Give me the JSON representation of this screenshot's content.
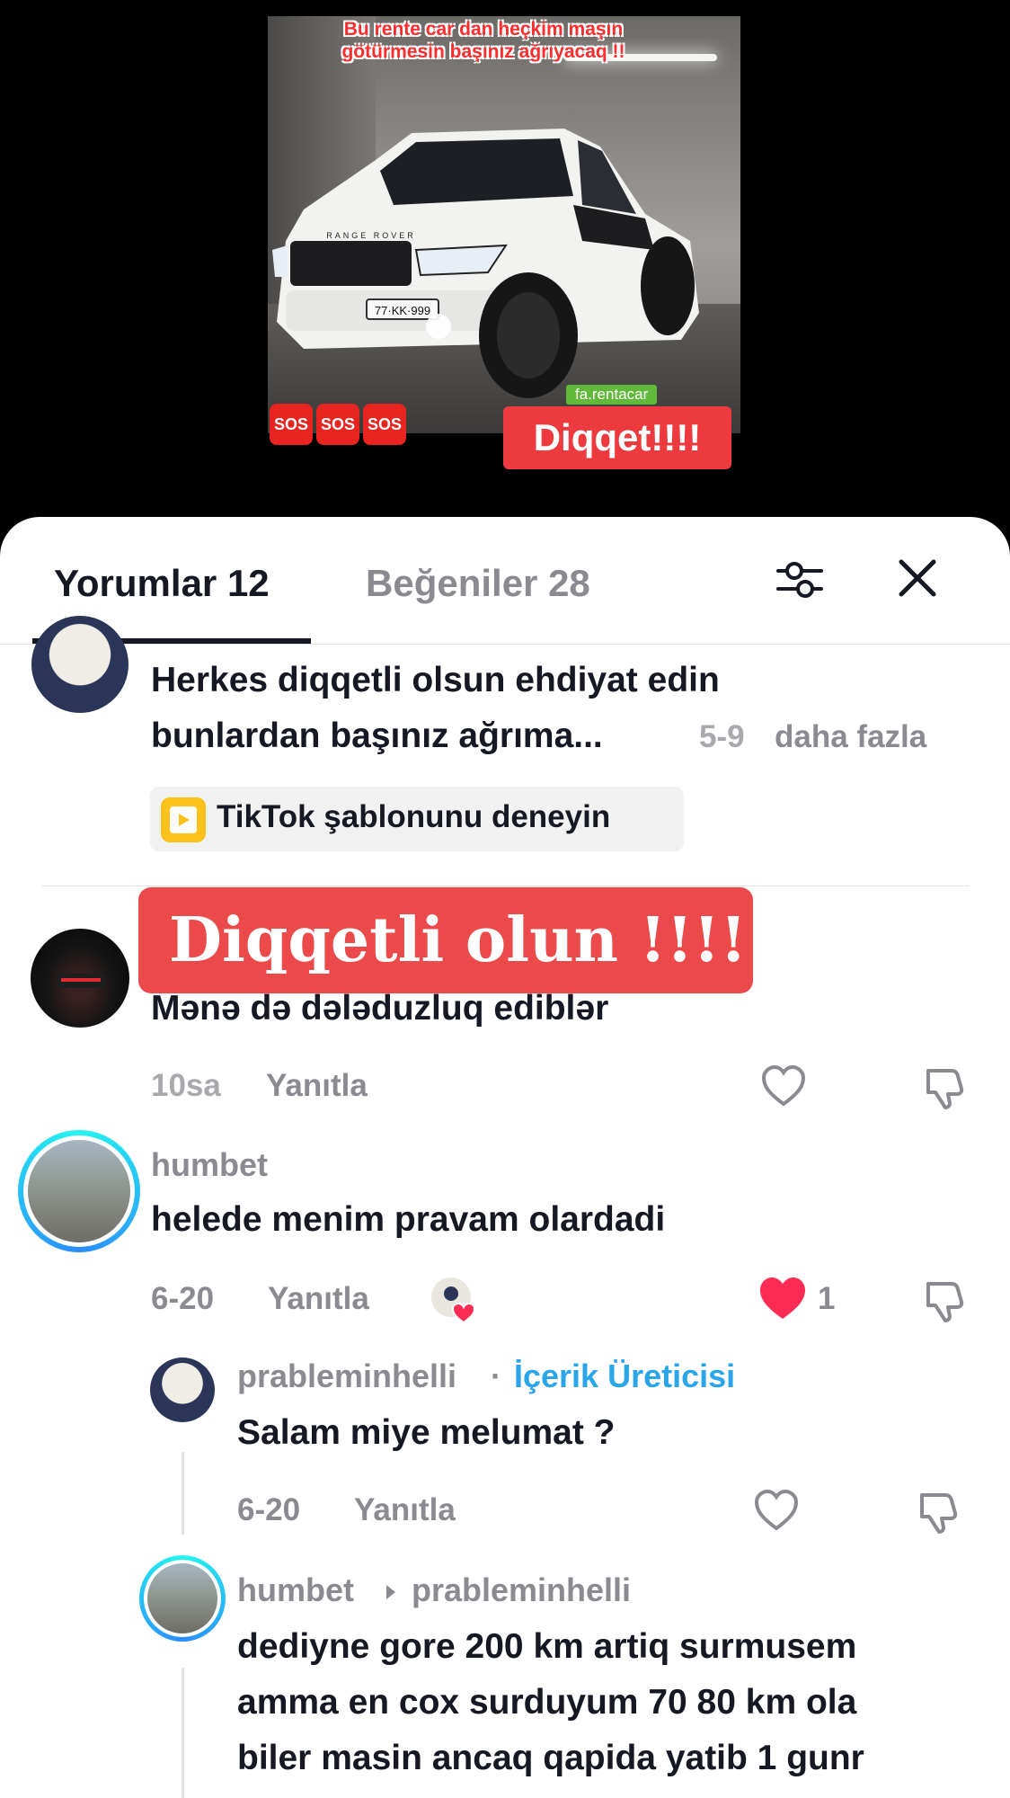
{
  "video": {
    "caption": "Bu rente car dan heçkim maşın götürmesin başınız ağrıyacaq !!",
    "watermark": "fa.rentacar",
    "plate": "77·KK·999",
    "car_badge": "RANGE ROVER",
    "sos_labels": [
      "SOS",
      "SOS",
      "SOS"
    ],
    "alert_badge": "Diqqet!!!!"
  },
  "tabs": {
    "comments": "Yorumlar 12",
    "likes": "Beğeniler 28"
  },
  "icons": {
    "filter": "filter-sliders-icon",
    "close": "close-icon",
    "like": "heart-outline-icon",
    "liked": "heart-filled-icon",
    "dislike": "thumbs-down-icon"
  },
  "colors": {
    "accent_red": "#ec3a3e",
    "liked_heart": "#fe2c55",
    "creator_badge": "#2aa6e8",
    "ring": "#25f4ee",
    "template_icon": "#fcc21b"
  },
  "comments": [
    {
      "text_line1": "Herkes diqqetli olsun ehdiyat edin",
      "text_line2": "bunlardan  başınız ağrıma...",
      "time": "5-9",
      "more": "daha fazla",
      "template_chip": "TikTok şablonunu deneyin"
    },
    {
      "overlay_banner": "Diqqetli olun !!!!",
      "text": "Mənə də dələduzluq ediblər",
      "time": "10sa",
      "reply": "Yanıtla"
    },
    {
      "name": "humbet",
      "text": "helede menim pravam olardadi",
      "time": "6-20",
      "reply": "Yanıtla",
      "likes": "1",
      "replies": [
        {
          "name": "prableminhelli",
          "separator": "·",
          "badge": "İçerik Üreticisi",
          "text": "Salam miye melumat ?",
          "time": "6-20",
          "reply": "Yanıtla"
        },
        {
          "name": "humbet",
          "reply_to": "prableminhelli",
          "line1": "dediyne gore 200 km artiq surmusem",
          "line2": "amma en cox surduyum 70 80 km ola",
          "line3": "biler masin ancaq qapida yatib 1 gunr"
        }
      ]
    }
  ]
}
